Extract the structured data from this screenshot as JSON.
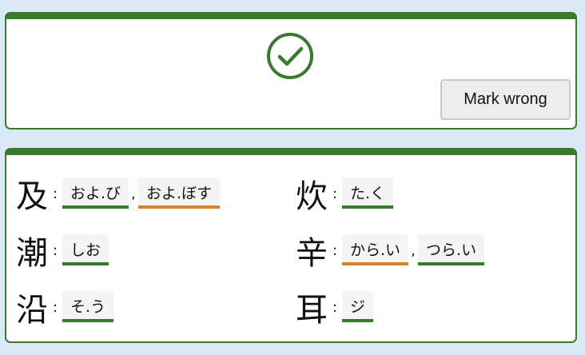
{
  "result": {
    "icon": "check-circle-icon",
    "status": "correct",
    "mark_wrong_label": "Mark wrong"
  },
  "colors": {
    "correct": "#3a7a2e",
    "wrong": "#d9812b",
    "background": "#dbe9f7"
  },
  "entries": [
    {
      "kanji": "及",
      "readings": [
        {
          "text": "およ.び",
          "status": "correct"
        },
        {
          "text": "およ.ぼす",
          "status": "wrong"
        }
      ]
    },
    {
      "kanji": "炊",
      "readings": [
        {
          "text": "た.く",
          "status": "correct"
        }
      ]
    },
    {
      "kanji": "潮",
      "readings": [
        {
          "text": "しお",
          "status": "correct"
        }
      ]
    },
    {
      "kanji": "辛",
      "readings": [
        {
          "text": "から.い",
          "status": "wrong"
        },
        {
          "text": "つら.い",
          "status": "correct"
        }
      ]
    },
    {
      "kanji": "沿",
      "readings": [
        {
          "text": "そ.う",
          "status": "correct"
        }
      ]
    },
    {
      "kanji": "耳",
      "readings": [
        {
          "text": "ジ",
          "status": "correct"
        }
      ]
    }
  ]
}
